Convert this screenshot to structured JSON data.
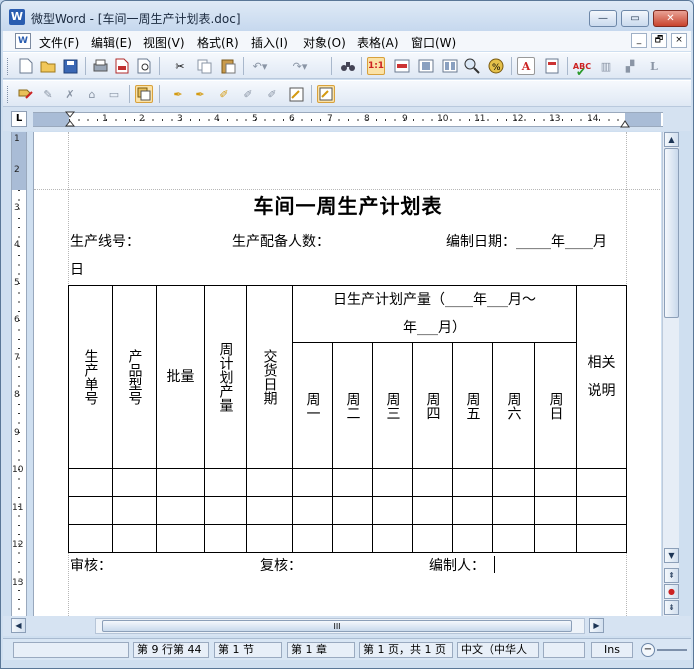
{
  "window": {
    "title": "微型Word - [车间一周生产计划表.doc]",
    "app_icon": "W",
    "minimize": "—",
    "restore": "▭",
    "close": "✕"
  },
  "menubar": {
    "items": [
      "文件(F)",
      "编辑(E)",
      "视图(V)",
      "格式(R)",
      "插入(I)",
      "对象(O)",
      "表格(A)",
      "窗口(W)"
    ],
    "doc_minimize": "_",
    "doc_restore": "🗗",
    "doc_close": "×"
  },
  "toolbar1": {
    "icons": [
      "new-doc-icon",
      "open-folder-icon",
      "save-icon",
      "print-icon",
      "pdf-export-icon",
      "print-preview-icon",
      "cut-icon",
      "copy-icon",
      "paste-icon",
      "undo-icon",
      "redo-icon",
      "find-icon",
      "actual-size-icon",
      "page-width-icon",
      "single-page-icon",
      "two-pages-icon",
      "zoom-icon",
      "zoom-percent-icon",
      "text-color-icon",
      "page-setup-icon",
      "spell-check-icon",
      "chart-icon",
      "shadow-icon",
      "line-spacing-icon"
    ]
  },
  "toolbar2": {
    "icons": [
      "draw-icon",
      "edit-draw-icon",
      "x-form-icon",
      "insert-shape-icon",
      "page-icon",
      "object-icon",
      "pen-icon",
      "pen-add-icon",
      "pen-edit-icon",
      "pen-delete-icon",
      "pen-erase-icon",
      "note-icon",
      "markup-icon"
    ]
  },
  "ruler": {
    "corner": "L",
    "h_labels": [
      "1",
      "2",
      "3",
      "4",
      "5",
      "6",
      "7",
      "8",
      "9",
      "10",
      "11",
      "12",
      "13",
      "14"
    ],
    "v_labels": [
      "1",
      "2",
      "3",
      "4",
      "5",
      "6",
      "7",
      "8",
      "9",
      "10",
      "11",
      "12",
      "13"
    ]
  },
  "document": {
    "title": "车间一周生产计划表",
    "line1": {
      "line_no": "生产线号：",
      "staff": "生产配备人数：",
      "date": "编制日期：_____年____月"
    },
    "line1_wrap": "日",
    "table": {
      "headers": {
        "order_no": "生产单号",
        "model": "产品型号",
        "batch": "批量",
        "plan_qty": "周计划产量",
        "delivery": "交货日期",
        "daily_top_a": "日生产计划产量（____年___月～",
        "daily_top_b": "年___月）",
        "days": [
          "周一",
          "周二",
          "周三",
          "周四",
          "周五",
          "周六",
          "周日"
        ],
        "remarks": "相关说明"
      },
      "empty_rows": 3
    },
    "footer": {
      "review": "审核：",
      "recheck": "复核：",
      "author": "编制人："
    }
  },
  "scroll": {
    "up": "▲",
    "down": "▼",
    "prev_page": "⇞",
    "select_browse": "●",
    "next_page": "⇟",
    "left": "◀",
    "right": "▶",
    "grip": "III"
  },
  "status": {
    "position": "第 9 行第 44",
    "section": "第 1 节",
    "chapter": "第 1 章",
    "page": "第 1 页，共 1 页",
    "language": "中文（中华人",
    "ins": "Ins"
  },
  "colors": {
    "chrome": "#cfdff0",
    "close_red": "#c8432c",
    "ruler_margin": "#a9bcd6"
  }
}
